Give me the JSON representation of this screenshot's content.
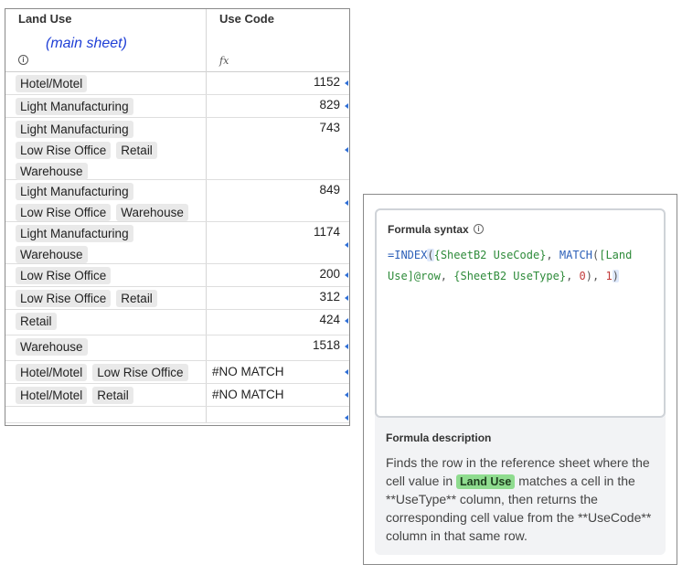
{
  "sheet": {
    "columns": [
      {
        "title": "Land Use",
        "note": "(main sheet)",
        "icon": "info-icon"
      },
      {
        "title": "Use Code",
        "icon": "function-icon"
      }
    ],
    "fx_label": "fx",
    "rows": [
      {
        "tags": [
          "Hotel/Motel"
        ],
        "value": "1152"
      },
      {
        "tags": [
          "Light Manufacturing"
        ],
        "value": "829"
      },
      {
        "tags": [
          "Light Manufacturing",
          "Low Rise Office",
          "Retail",
          "Warehouse"
        ],
        "value": "743"
      },
      {
        "tags": [
          "Light Manufacturing",
          "Low Rise Office",
          "Warehouse"
        ],
        "value": "849"
      },
      {
        "tags": [
          "Light Manufacturing",
          "Warehouse"
        ],
        "value": "1174"
      },
      {
        "tags": [
          "Low Rise Office"
        ],
        "value": "200"
      },
      {
        "tags": [
          "Low Rise Office",
          "Retail"
        ],
        "value": "312"
      },
      {
        "tags": [
          "Retail"
        ],
        "value": "424"
      },
      {
        "tags": [
          "Warehouse"
        ],
        "value": "1518"
      },
      {
        "tags": [
          "Hotel/Motel",
          "Low Rise Office"
        ],
        "value": "#NO MATCH"
      },
      {
        "tags": [
          "Hotel/Motel",
          "Retail"
        ],
        "value": "#NO MATCH"
      },
      {
        "tags": [],
        "value": ""
      }
    ]
  },
  "panel": {
    "syntax_title": "Formula syntax",
    "formula": {
      "fn1": "=INDEX",
      "p1": "(",
      "ref1": "{SheetB2 UseCode}",
      "sep1": ", ",
      "fn2": "MATCH",
      "p2": "(",
      "ref2": "[Land Use]@row",
      "sep2": ", ",
      "ref3": "{SheetB2 UseType}",
      "sep3": ", ",
      "num1": "0",
      "p3": "), ",
      "num2": "1",
      "p4": ")"
    },
    "description_title": "Formula description",
    "description": {
      "before": "Finds the row in the reference sheet where the cell value in ",
      "chip": "Land Use",
      "after": " matches a cell in the **UseType** column, then returns the corresponding cell value from the **UseCode** column in that same row."
    }
  },
  "colors": {
    "accent_blue": "#2f6fd6",
    "note_blue": "#1f3fd6",
    "chip_green": "#8fdc8f",
    "formula_ref_green": "#2e8b3a",
    "formula_num_red": "#c23a3a"
  }
}
